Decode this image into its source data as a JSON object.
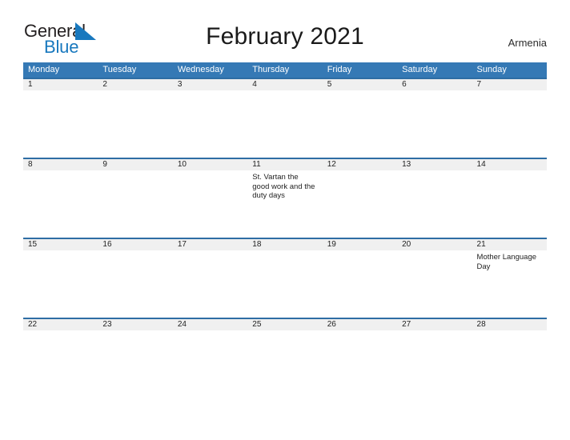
{
  "brand": {
    "word_one": "General",
    "word_two": "Blue",
    "flag_icon": "flag-triangle-icon",
    "color_dark": "#231f20",
    "color_blue": "#1878be"
  },
  "header": {
    "title": "February 2021",
    "region": "Armenia"
  },
  "theme": {
    "header_blue": "#3579b5",
    "row_rule_blue": "#2e6da4",
    "day_band_gray": "#f0f0f0",
    "page_background": "#ffffff"
  },
  "calendar": {
    "weekdays": [
      "Monday",
      "Tuesday",
      "Wednesday",
      "Thursday",
      "Friday",
      "Saturday",
      "Sunday"
    ],
    "weeks": [
      {
        "days": [
          {
            "date": "1",
            "event": ""
          },
          {
            "date": "2",
            "event": ""
          },
          {
            "date": "3",
            "event": ""
          },
          {
            "date": "4",
            "event": ""
          },
          {
            "date": "5",
            "event": ""
          },
          {
            "date": "6",
            "event": ""
          },
          {
            "date": "7",
            "event": ""
          }
        ]
      },
      {
        "days": [
          {
            "date": "8",
            "event": ""
          },
          {
            "date": "9",
            "event": ""
          },
          {
            "date": "10",
            "event": ""
          },
          {
            "date": "11",
            "event": "St. Vartan the good work and the duty days"
          },
          {
            "date": "12",
            "event": ""
          },
          {
            "date": "13",
            "event": ""
          },
          {
            "date": "14",
            "event": ""
          }
        ]
      },
      {
        "days": [
          {
            "date": "15",
            "event": ""
          },
          {
            "date": "16",
            "event": ""
          },
          {
            "date": "17",
            "event": ""
          },
          {
            "date": "18",
            "event": ""
          },
          {
            "date": "19",
            "event": ""
          },
          {
            "date": "20",
            "event": ""
          },
          {
            "date": "21",
            "event": "Mother Language Day"
          }
        ]
      },
      {
        "days": [
          {
            "date": "22",
            "event": ""
          },
          {
            "date": "23",
            "event": ""
          },
          {
            "date": "24",
            "event": ""
          },
          {
            "date": "25",
            "event": ""
          },
          {
            "date": "26",
            "event": ""
          },
          {
            "date": "27",
            "event": ""
          },
          {
            "date": "28",
            "event": ""
          }
        ]
      }
    ]
  }
}
